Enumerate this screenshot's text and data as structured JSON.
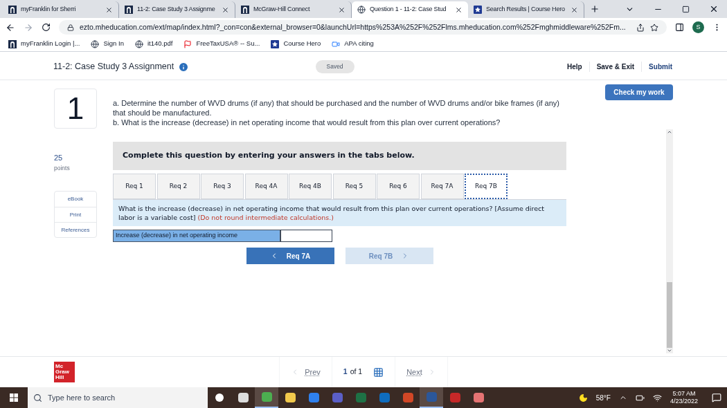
{
  "browser": {
    "tabs": [
      {
        "title": "myFranklin for Sherri",
        "selected": false,
        "kind": "franklin"
      },
      {
        "title": "11-2: Case Study 3 Assignme",
        "selected": false,
        "kind": "franklin"
      },
      {
        "title": "McGraw-Hill Connect",
        "selected": false,
        "kind": "franklin"
      },
      {
        "title": "Question 1 - 11-2: Case Stud",
        "selected": true,
        "kind": "globe"
      },
      {
        "title": "Search Results | Course Hero",
        "selected": false,
        "kind": "star"
      }
    ],
    "url": "ezto.mheducation.com/ext/map/index.html?_con=con&external_browser=0&launchUrl=https%253A%252F%252Flms.mheducation.com%252Fmghmiddleware%252Fm...",
    "profile": "S",
    "bookmarks": [
      {
        "label": "myFranklin Login |...",
        "kind": "franklin"
      },
      {
        "label": "Sign In",
        "kind": "globe"
      },
      {
        "label": "it140.pdf",
        "kind": "globe"
      },
      {
        "label": "FreeTaxUSA® -- Su...",
        "kind": "flag"
      },
      {
        "label": "Course Hero",
        "kind": "star"
      },
      {
        "label": "APA citing",
        "kind": "video"
      }
    ]
  },
  "header": {
    "title": "11-2: Case Study 3 Assignment",
    "status": "Saved",
    "links": [
      "Help",
      "Save & Exit",
      "Submit"
    ]
  },
  "question": {
    "number": "1",
    "points": "25",
    "points_label": "points",
    "check_button": "Check my work",
    "resources": [
      "eBook",
      "Print",
      "References"
    ],
    "text_lines": [
      "a. Determine the number of WVD drums (if any) that should be purchased and the number of WVD drums and/or bike frames (if any)",
      "that should be manufactured.",
      "b. What is the increase (decrease) in net operating income that would result from this plan over current operations?"
    ],
    "instructions": "Complete this question by entering your answers in the tabs below.",
    "tabs": [
      {
        "label": "Req 1",
        "selected": false
      },
      {
        "label": "Req 2",
        "selected": false
      },
      {
        "label": "Req 3",
        "selected": false
      },
      {
        "label": "Req 4A",
        "selected": false
      },
      {
        "label": "Req 4B",
        "selected": false
      },
      {
        "label": "Req 5",
        "selected": false
      },
      {
        "label": "Req 6",
        "selected": false
      },
      {
        "label": "Req 7A",
        "selected": false
      },
      {
        "label": "Req 7B",
        "selected": true
      }
    ],
    "prompt": "What is the increase (decrease) in net operating income that would result from this plan over current operations? [Assume direct labor is a variable cost]",
    "prompt_note": "(Do not round intermediate calculations.)",
    "answer_label": "Increase (decrease) in net operating income",
    "prev_button": {
      "label": "Req 7A",
      "disabled": false
    },
    "next_button": {
      "label": "Req 7B",
      "disabled": true
    }
  },
  "footer": {
    "logo": [
      "Mc",
      "Graw",
      "Hill"
    ],
    "prev": "Prev",
    "page": "1",
    "of": "of 1",
    "next": "Next"
  },
  "taskbar": {
    "search_placeholder": "Type here to search",
    "weather": "58°F",
    "time": "5:07 AM",
    "date": "4/23/2022",
    "apps": [
      {
        "color": "#ffffff",
        "selected": false
      },
      {
        "color": "#dddddd",
        "selected": false
      },
      {
        "color": "#4caf50",
        "selected": true
      },
      {
        "color": "#f2c94c",
        "selected": false
      },
      {
        "color": "#2f80ed",
        "selected": false
      },
      {
        "color": "#5b5fc7",
        "selected": false
      },
      {
        "color": "#1e7145",
        "selected": false
      },
      {
        "color": "#0f6cbd",
        "selected": false
      },
      {
        "color": "#d24726",
        "selected": false
      },
      {
        "color": "#2b579a",
        "selected": true
      },
      {
        "color": "#c62828",
        "selected": false
      },
      {
        "color": "#e57373",
        "selected": false
      }
    ]
  }
}
